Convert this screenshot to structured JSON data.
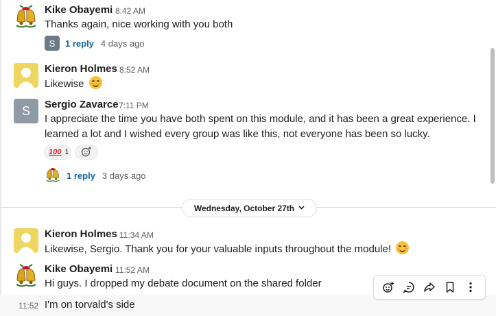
{
  "messages": [
    {
      "author": "Kike Obayemi",
      "time": "8:42 AM",
      "text": "Thanks again, nice working with you both",
      "avatar_icon": "christmas-bells-icon",
      "thread": {
        "avatar_letter": "S",
        "count": "1 reply",
        "ago": "4 days ago"
      }
    },
    {
      "author": "Kieron Holmes",
      "time": "8:52 AM",
      "text": "Likewise",
      "avatar_icon": "default-yellow-avatar-icon",
      "emoji": "smiling-face-icon"
    },
    {
      "author": "Sergio Zavarce",
      "time": "7:11 PM",
      "avatar_letter": "S",
      "text_line1": "I appreciate the time you have both spent on this module, and it has been a great experience. I",
      "text_line2": "learned a lot and I wished every group was like this, not everyone has been so lucky.",
      "reaction": {
        "emoji_label": "100",
        "count": "1"
      },
      "thread": {
        "avatar_icon": "christmas-bells-icon",
        "count": "1 reply",
        "ago": "3 days ago"
      }
    },
    {
      "author": "Kieron Holmes",
      "time": "11:34 AM",
      "text": "Likewise, Sergio. Thank you for your valuable inputs throughout the module!",
      "avatar_icon": "default-yellow-avatar-icon",
      "emoji": "smiling-face-icon"
    },
    {
      "author": "Kike Obayemi",
      "time": "11:52 AM",
      "text": "Hi guys. I dropped my debate document on the shared folder",
      "avatar_icon": "christmas-bells-icon"
    },
    {
      "time": "11:52",
      "text": "I'm on torvald's side"
    }
  ],
  "date_divider": {
    "label": "Wednesday, October 27th",
    "icon": "chevron-down-icon"
  },
  "hover_toolbar": [
    "add-reaction-icon",
    "reply-in-thread-icon",
    "share-icon",
    "bookmark-icon",
    "more-actions-icon"
  ],
  "colors": {
    "link": "#1264a3",
    "yellow_avatar": "#efd660",
    "s_avatar": "#8e9aa6"
  }
}
